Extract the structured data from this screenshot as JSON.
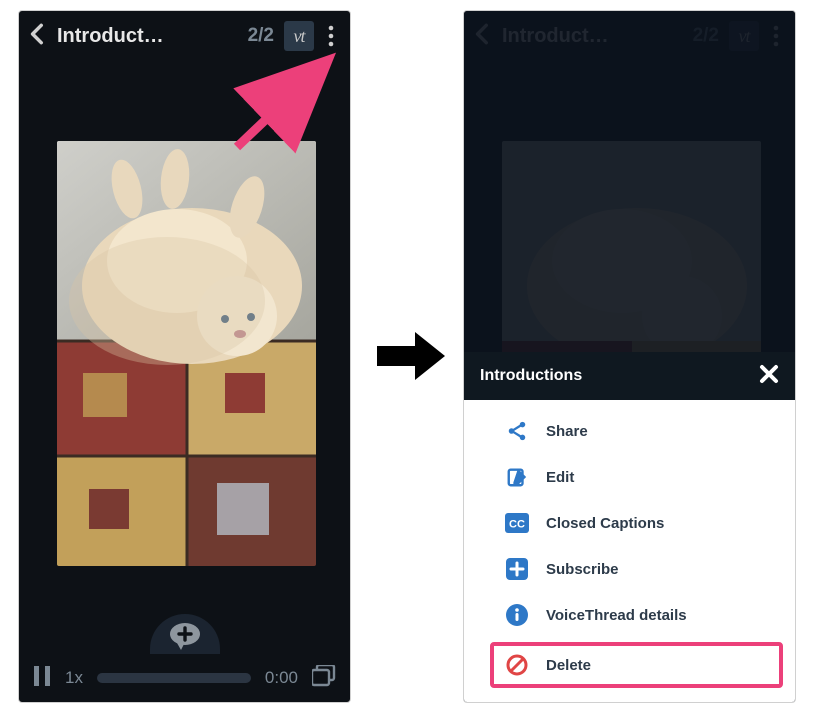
{
  "left": {
    "title": "Introduct…",
    "counter": "2/2",
    "vt": "vt",
    "speed": "1x",
    "time": "0:00"
  },
  "right": {
    "title": "Introduct…",
    "counter": "2/2",
    "vt": "vt",
    "menu_title": "Introductions",
    "menu_items": {
      "share": "Share",
      "edit": "Edit",
      "cc": "Closed Captions",
      "subscribe": "Subscribe",
      "details": "VoiceThread details",
      "delete": "Delete"
    }
  }
}
